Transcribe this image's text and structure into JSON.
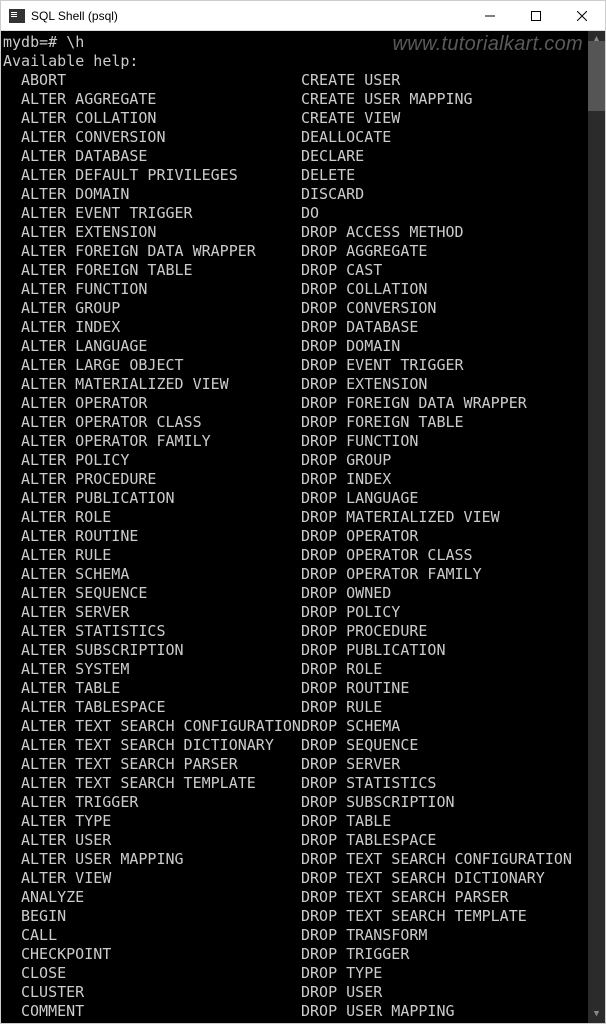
{
  "window": {
    "title": "SQL Shell (psql)"
  },
  "watermark": "www.tutorialkart.com",
  "terminal": {
    "prompt": "mydb=# \\h",
    "header": "Available help:",
    "col1": [
      "ABORT",
      "ALTER AGGREGATE",
      "ALTER COLLATION",
      "ALTER CONVERSION",
      "ALTER DATABASE",
      "ALTER DEFAULT PRIVILEGES",
      "ALTER DOMAIN",
      "ALTER EVENT TRIGGER",
      "ALTER EXTENSION",
      "ALTER FOREIGN DATA WRAPPER",
      "ALTER FOREIGN TABLE",
      "ALTER FUNCTION",
      "ALTER GROUP",
      "ALTER INDEX",
      "ALTER LANGUAGE",
      "ALTER LARGE OBJECT",
      "ALTER MATERIALIZED VIEW",
      "ALTER OPERATOR",
      "ALTER OPERATOR CLASS",
      "ALTER OPERATOR FAMILY",
      "ALTER POLICY",
      "ALTER PROCEDURE",
      "ALTER PUBLICATION",
      "ALTER ROLE",
      "ALTER ROUTINE",
      "ALTER RULE",
      "ALTER SCHEMA",
      "ALTER SEQUENCE",
      "ALTER SERVER",
      "ALTER STATISTICS",
      "ALTER SUBSCRIPTION",
      "ALTER SYSTEM",
      "ALTER TABLE",
      "ALTER TABLESPACE",
      "ALTER TEXT SEARCH CONFIGURATION",
      "ALTER TEXT SEARCH DICTIONARY",
      "ALTER TEXT SEARCH PARSER",
      "ALTER TEXT SEARCH TEMPLATE",
      "ALTER TRIGGER",
      "ALTER TYPE",
      "ALTER USER",
      "ALTER USER MAPPING",
      "ALTER VIEW",
      "ANALYZE",
      "BEGIN",
      "CALL",
      "CHECKPOINT",
      "CLOSE",
      "CLUSTER",
      "COMMENT"
    ],
    "col2": [
      "CREATE USER",
      "CREATE USER MAPPING",
      "CREATE VIEW",
      "DEALLOCATE",
      "DECLARE",
      "DELETE",
      "DISCARD",
      "DO",
      "DROP ACCESS METHOD",
      "DROP AGGREGATE",
      "DROP CAST",
      "DROP COLLATION",
      "DROP CONVERSION",
      "DROP DATABASE",
      "DROP DOMAIN",
      "DROP EVENT TRIGGER",
      "DROP EXTENSION",
      "DROP FOREIGN DATA WRAPPER",
      "DROP FOREIGN TABLE",
      "DROP FUNCTION",
      "DROP GROUP",
      "DROP INDEX",
      "DROP LANGUAGE",
      "DROP MATERIALIZED VIEW",
      "DROP OPERATOR",
      "DROP OPERATOR CLASS",
      "DROP OPERATOR FAMILY",
      "DROP OWNED",
      "DROP POLICY",
      "DROP PROCEDURE",
      "DROP PUBLICATION",
      "DROP ROLE",
      "DROP ROUTINE",
      "DROP RULE",
      "DROP SCHEMA",
      "DROP SEQUENCE",
      "DROP SERVER",
      "DROP STATISTICS",
      "DROP SUBSCRIPTION",
      "DROP TABLE",
      "DROP TABLESPACE",
      "DROP TEXT SEARCH CONFIGURATION",
      "DROP TEXT SEARCH DICTIONARY",
      "DROP TEXT SEARCH PARSER",
      "DROP TEXT SEARCH TEMPLATE",
      "DROP TRANSFORM",
      "DROP TRIGGER",
      "DROP TYPE",
      "DROP USER",
      "DROP USER MAPPING"
    ]
  }
}
